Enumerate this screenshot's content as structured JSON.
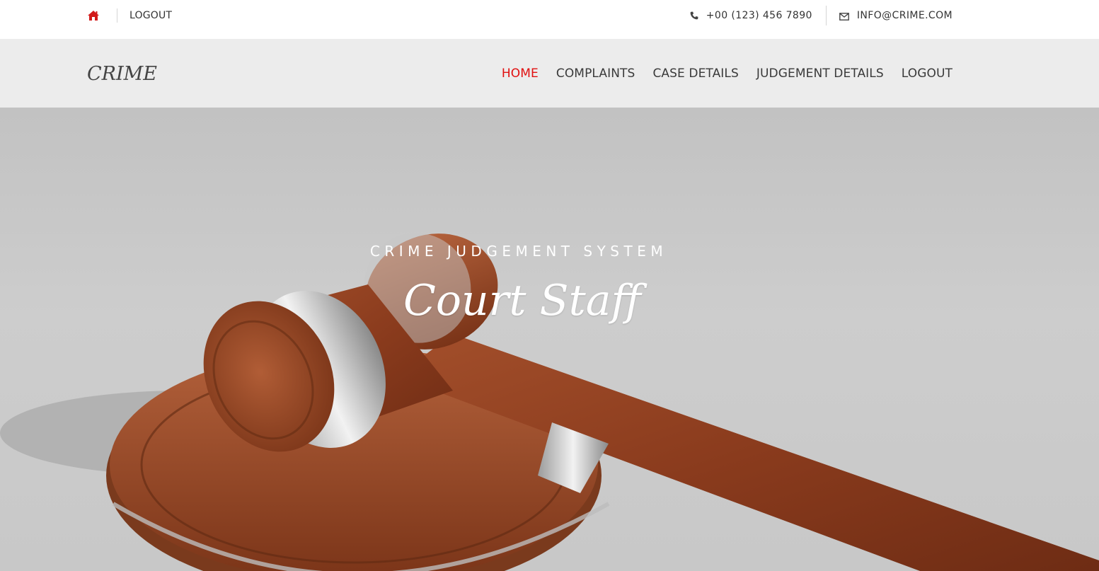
{
  "topbar": {
    "home_icon": "home-icon",
    "logout_label": "LOGOUT",
    "phone_icon": "phone-icon",
    "phone": "+00 (123) 456 7890",
    "mail_icon": "envelope-icon",
    "email": "INFO@CRIME.COM"
  },
  "navbar": {
    "brand": "CRIME",
    "items": [
      {
        "label": "HOME",
        "active": true
      },
      {
        "label": "COMPLAINTS",
        "active": false
      },
      {
        "label": "CASE DETAILS",
        "active": false
      },
      {
        "label": "JUDGEMENT DETAILS",
        "active": false
      },
      {
        "label": "LOGOUT",
        "active": false
      }
    ]
  },
  "hero": {
    "subtitle": "CRIME JUDGEMENT SYSTEM",
    "title": "Court Staff",
    "image": "gavel-image"
  },
  "colors": {
    "accent": "#e01010",
    "nav_bg": "#ececec",
    "text": "#333333"
  }
}
